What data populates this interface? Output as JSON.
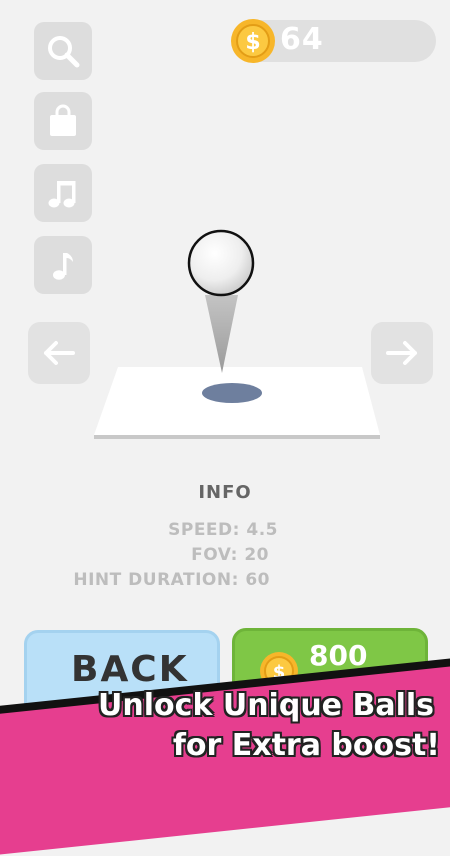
{
  "currency": {
    "amount": "64",
    "symbol": "$"
  },
  "sidebar": {
    "items": [
      {
        "name": "search-button",
        "icon": "search-icon"
      },
      {
        "name": "shop-button",
        "icon": "shopping-bag-icon"
      },
      {
        "name": "music-button",
        "icon": "music-notes-icon"
      },
      {
        "name": "sound-button",
        "icon": "music-note-icon"
      }
    ]
  },
  "info": {
    "title": "INFO",
    "stats": [
      {
        "label": "SPEED:",
        "value": "4.5"
      },
      {
        "label": "FOV:",
        "value": "20"
      },
      {
        "label": "HINT DURATION:",
        "value": "60"
      }
    ]
  },
  "buttons": {
    "back_label": "BACK",
    "buy_price": "800"
  },
  "banner": {
    "line1": "Unlock Unique Balls",
    "line2": "for Extra boost!"
  },
  "colors": {
    "background": "#f2f2f2",
    "back_button": "#b9e0f8",
    "buy_button": "#7fc746",
    "banner": "#e63e8f",
    "coin": "#f7b62a"
  }
}
